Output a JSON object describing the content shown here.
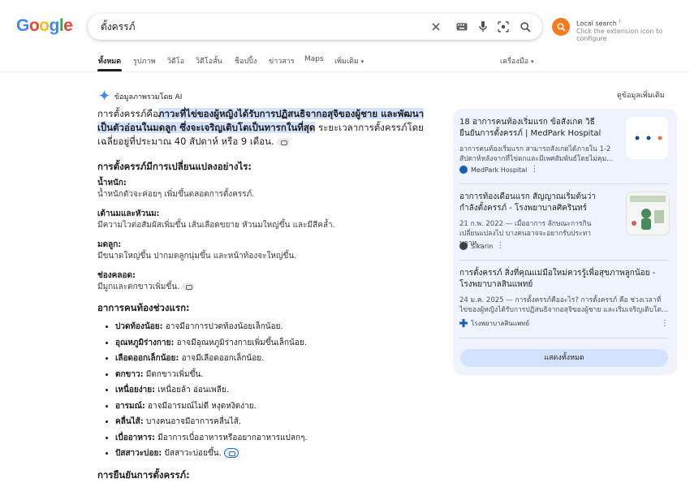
{
  "search": {
    "query": "ตั้งครรภ์"
  },
  "logo": {
    "letters": [
      "G",
      "o",
      "o",
      "g",
      "l",
      "e"
    ],
    "colors": [
      "#4285F4",
      "#EA4335",
      "#FBBC05",
      "#4285F4",
      "#34A853",
      "#EA4335"
    ]
  },
  "extension": {
    "title": "Local search",
    "subtitle": "Click the extension icon to configure"
  },
  "tabs": [
    {
      "label": "ทั้งหมด",
      "active": true
    },
    {
      "label": "รูปภาพ"
    },
    {
      "label": "วิดีโอ"
    },
    {
      "label": "วิดีโอสั้น"
    },
    {
      "label": "ช็อปปิ้ง"
    },
    {
      "label": "ข่าวสาร"
    },
    {
      "label": "Maps"
    },
    {
      "label": "เพิ่มเติม"
    }
  ],
  "tools_label": "เครื่องมือ",
  "ai_overview": {
    "label": "ข้อมูลภาพรวมโดย AI",
    "more_info": "ดูข้อมูลเพิ่มเติม",
    "intro_prefix": "การตั้งครรภ์คือ",
    "intro_highlight": "ภาวะที่ไข่ของผู้หญิงได้รับการปฏิสนธิจากอสุจิของผู้ชาย และพัฒนาเป็นตัวอ่อนในมดลูก ซึ่งจะเจริญเติบโตเป็นทารกในที่สุด",
    "intro_suffix": " ระยะเวลาการตั้งครรภ์โดยเฉลี่ยอยู่ที่ประมาณ 40 สัปดาห์ หรือ 9 เดือน.",
    "section1_title": "การตั้งครรภ์มีการเปลี่ยนแปลงอย่างไร:",
    "changes": [
      {
        "title": "น้ำหนัก:",
        "text": "น้ำหนักตัวจะค่อยๆ เพิ่มขึ้นตลอดการตั้งครรภ์."
      },
      {
        "title": "เต้านมและหัวนม:",
        "text": "มีความไวต่อสัมผัสเพิ่มขึ้น เส้นเลือดขยาย หัวนมใหญ่ขึ้น และมีสีคล้ำ."
      },
      {
        "title": "มดลูก:",
        "text": "มีขนาดใหญ่ขึ้น ปากมดลูกนุ่มขึ้น และหน้าท้องจะใหญ่ขึ้น."
      },
      {
        "title": "ช่องคลอด:",
        "text": "มีมูกและตกขาวเพิ่มขึ้น."
      }
    ],
    "section2_title": "อาการคนท้องช่วงแรก:",
    "symptoms": [
      {
        "term": "ปวดท้องน้อย:",
        "desc": " อาจมีอาการปวดท้องน้อยเล็กน้อย."
      },
      {
        "term": "อุณหภูมิร่างกาย:",
        "desc": " อาจมีอุณหภูมิร่างกายเพิ่มขึ้นเล็กน้อย."
      },
      {
        "term": "เลือดออกเล็กน้อย:",
        "desc": " อาจมีเลือดออกเล็กน้อย."
      },
      {
        "term": "ตกขาว:",
        "desc": " มีตกขาวเพิ่มขึ้น."
      },
      {
        "term": "เหนื่อยง่าย:",
        "desc": " เหนื่อยล้า อ่อนเพลีย."
      },
      {
        "term": "อารมณ์:",
        "desc": " อาจมีอารมณ์ไม่ดี หงุดหงิดง่าย."
      },
      {
        "term": "คลื่นไส้:",
        "desc": " บางคนอาจมีอาการคลื่นไส้."
      },
      {
        "term": "เบื่ออาหาร:",
        "desc": " มีอาการเบื่ออาหารหรืออยากอาหารแปลกๆ."
      },
      {
        "term": "ปัสสาวะบ่อย:",
        "desc": " ปัสสาวะบ่อยขึ้น."
      }
    ],
    "section3_title": "การยืนยันการตั้งครรภ์:"
  },
  "sources": [
    {
      "title": "18 อาการคนท้องเริ่มแรก ข้อสังเกต วิธียืนยันการตั้งครรภ์ | MedPark Hospital",
      "snippet": "อาการคนท้องเริ่มแรก สามารถสังเกตได้ภายใน 1-2 สัปดาห์หลังจากที่ไข่ตกและมีเพศสัมพันธ์โดยไม่คุม...",
      "source": "MedPark Hospital"
    },
    {
      "title": "อาการท้องเดือนแรก สัญญาณเริ่มต้นว่ากำลังตั้งครรภ์ - โรงพยาบาลศิครินทร์",
      "snippet": "21 ก.พ. 2022 — เมื่ออาการ ลักษณะการกิน เปลี่ยนแปลงไป บางคนอาจจะอยากรับประทานอาห...",
      "source": "Sikarin"
    },
    {
      "title": "การตั้งครรภ์ สิ่งที่คุณแม่มือใหม่ควรรู้เพื่อสุขภาพลูกน้อย - โรงพยาบาลสินแพทย์",
      "snippet": "24 ม.ค. 2025 — การตั้งครรภ์คืออะไร? การตั้งครรภ์ คือ ช่วงเวลาที่ไข่ของผู้หญิงได้รับการปฏิสนธิจากอสุจิของผู้ชาย และเริ่มเจริญเติบโต...",
      "source": "โรงพยาบาลสินแพทย์"
    }
  ],
  "show_all": "แสดงทั้งหมด"
}
